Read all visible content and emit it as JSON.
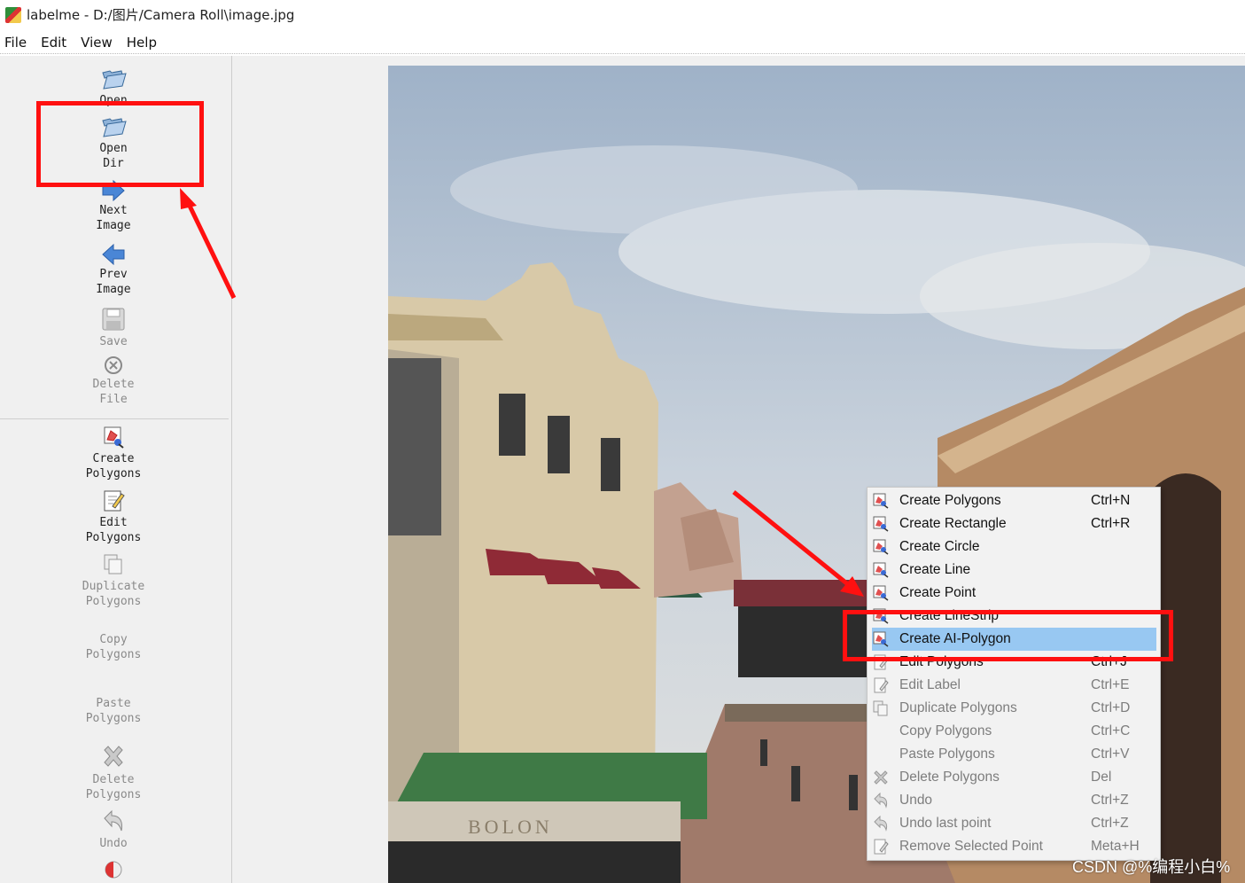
{
  "window": {
    "title": "labelme - D:/图片/Camera Roll\\image.jpg"
  },
  "menu": [
    "File",
    "Edit",
    "View",
    "Help"
  ],
  "toolbar": {
    "open": "Open",
    "open_dir_line1": "Open",
    "open_dir_line2": "Dir",
    "next_line1": "Next",
    "next_line2": "Image",
    "prev_line1": "Prev",
    "prev_line2": "Image",
    "save": "Save",
    "delete_file_line1": "Delete",
    "delete_file_line2": "File",
    "create_poly_line1": "Create",
    "create_poly_line2": "Polygons",
    "edit_poly_line1": "Edit",
    "edit_poly_line2": "Polygons",
    "dup_poly_line1": "Duplicate",
    "dup_poly_line2": "Polygons",
    "copy_poly_line1": "Copy",
    "copy_poly_line2": "Polygons",
    "paste_poly_line1": "Paste",
    "paste_poly_line2": "Polygons",
    "del_poly_line1": "Delete",
    "del_poly_line2": "Polygons",
    "undo": "Undo"
  },
  "context_menu": [
    {
      "label": "Create Polygons",
      "shortcut": "Ctrl+N",
      "icon": "create-icon",
      "enabled": true
    },
    {
      "label": "Create Rectangle",
      "shortcut": "Ctrl+R",
      "icon": "create-icon",
      "enabled": true
    },
    {
      "label": "Create Circle",
      "shortcut": "",
      "icon": "create-icon",
      "enabled": true
    },
    {
      "label": "Create Line",
      "shortcut": "",
      "icon": "create-icon",
      "enabled": true
    },
    {
      "label": "Create Point",
      "shortcut": "",
      "icon": "create-icon",
      "enabled": true
    },
    {
      "label": "Create LineStrip",
      "shortcut": "",
      "icon": "create-icon",
      "enabled": true
    },
    {
      "label": "Create AI-Polygon",
      "shortcut": "",
      "icon": "create-icon",
      "enabled": true,
      "highlighted": true
    },
    {
      "label": "Edit Polygons",
      "shortcut": "Ctrl+J",
      "icon": "edit-icon",
      "enabled": true
    },
    {
      "label": "Edit Label",
      "shortcut": "Ctrl+E",
      "icon": "edit-icon",
      "enabled": false
    },
    {
      "label": "Duplicate Polygons",
      "shortcut": "Ctrl+D",
      "icon": "copy-icon",
      "enabled": false
    },
    {
      "label": "Copy Polygons",
      "shortcut": "Ctrl+C",
      "icon": "",
      "enabled": false
    },
    {
      "label": "Paste Polygons",
      "shortcut": "Ctrl+V",
      "icon": "",
      "enabled": false
    },
    {
      "label": "Delete Polygons",
      "shortcut": "Del",
      "icon": "cancel-icon",
      "enabled": false
    },
    {
      "label": "Undo",
      "shortcut": "Ctrl+Z",
      "icon": "undo-icon",
      "enabled": false
    },
    {
      "label": "Undo last point",
      "shortcut": "Ctrl+Z",
      "icon": "undo-icon",
      "enabled": false
    },
    {
      "label": "Remove Selected Point",
      "shortcut": "Meta+H",
      "icon": "edit-icon",
      "enabled": false
    }
  ],
  "photo": {
    "sign_text": "BOLON"
  },
  "watermark": "CSDN @%编程小白%",
  "colors": {
    "annotation_red": "#ff1010",
    "menu_highlight": "#98c8f2",
    "toolbar_bg": "#f0f0f0"
  }
}
